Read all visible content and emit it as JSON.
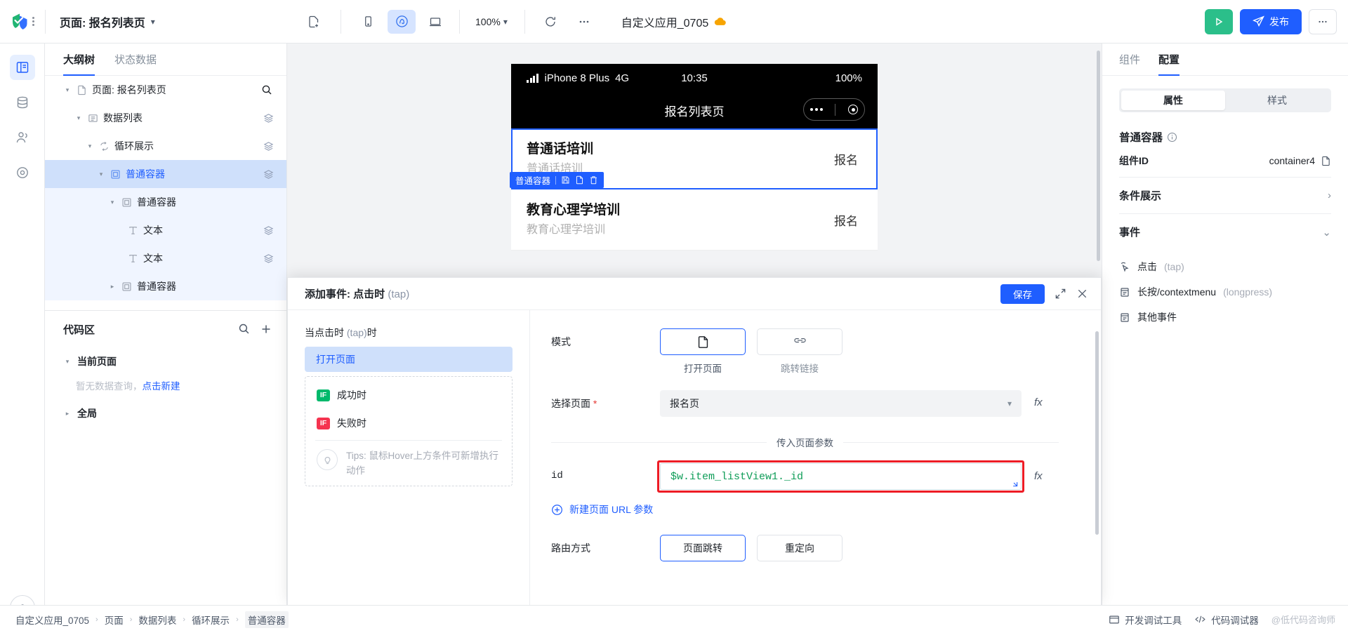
{
  "topbar": {
    "page_label": "页面: 报名列表页",
    "new_page_icon": "file-plus-icon",
    "device_mobile_icon": "mobile-icon",
    "device_miniapp_icon": "miniapp-icon",
    "device_desktop_icon": "desktop-icon",
    "zoom": "100%",
    "refresh_icon": "refresh-icon",
    "more_icon": "ellipsis-icon",
    "app_name": "自定义应用_0705",
    "cloud_icon": "cloud-icon",
    "preview_label": "preview",
    "publish_label": "发布",
    "more_label": "more"
  },
  "rail": {
    "items": [
      {
        "icon": "layout-icon",
        "name": "rail-item-layout",
        "active": true
      },
      {
        "icon": "database-icon",
        "name": "rail-item-data",
        "active": false
      },
      {
        "icon": "users-icon",
        "name": "rail-item-users",
        "active": false
      },
      {
        "icon": "target-icon",
        "name": "rail-item-settings",
        "active": false
      }
    ],
    "help_icon": "question-icon"
  },
  "left_panel": {
    "tabs": [
      {
        "label": "大纲树",
        "active": true
      },
      {
        "label": "状态数据",
        "active": false
      }
    ],
    "search_icon": "search-icon",
    "tree": [
      {
        "label": "页面: 报名列表页",
        "icon": "file-icon",
        "depth": 0,
        "caret": "down",
        "state": "none",
        "layers": false
      },
      {
        "label": "数据列表",
        "icon": "list-icon",
        "depth": 1,
        "caret": "down",
        "state": "none",
        "layers": true
      },
      {
        "label": "循环展示",
        "icon": "loop-icon",
        "depth": 2,
        "caret": "down",
        "state": "none",
        "layers": true
      },
      {
        "label": "普通容器",
        "icon": "container-icon",
        "depth": 3,
        "caret": "down",
        "state": "sel",
        "layers": true
      },
      {
        "label": "普通容器",
        "icon": "container-icon",
        "depth": 4,
        "caret": "down",
        "state": "childsel",
        "layers": false
      },
      {
        "label": "文本",
        "icon": "text-icon",
        "depth": 5,
        "caret": "none",
        "state": "childsel",
        "layers": true
      },
      {
        "label": "文本",
        "icon": "text-icon",
        "depth": 5,
        "caret": "none",
        "state": "childsel",
        "layers": true
      },
      {
        "label": "普通容器",
        "icon": "container-icon",
        "depth": 4,
        "caret": "right",
        "state": "childsel",
        "layers": false
      }
    ],
    "code_section": {
      "title": "代码区",
      "search_icon": "search-icon",
      "add_icon": "plus-icon",
      "current_page_label": "当前页面",
      "empty_text": "暂无数据查询，",
      "empty_link": "点击新建",
      "global_label": "全局"
    }
  },
  "canvas": {
    "phone": {
      "carrier": "iPhone 8 Plus",
      "network": "4G",
      "time": "10:35",
      "battery": "100%",
      "nav_title": "报名列表页",
      "list": [
        {
          "title": "普通话培训",
          "subtitle": "普通话培训",
          "action": "报名",
          "highlight": true
        },
        {
          "title": "教育心理学培训",
          "subtitle": "教育心理学培训",
          "action": "报名",
          "highlight": false
        }
      ],
      "selection_badge": {
        "label": "普通容器",
        "icons": [
          "save-icon",
          "copy-icon",
          "delete-icon"
        ]
      }
    }
  },
  "right_panel": {
    "tabs": [
      {
        "label": "组件",
        "active": false
      },
      {
        "label": "配置",
        "active": true
      }
    ],
    "segments": [
      {
        "label": "属性",
        "active": true
      },
      {
        "label": "样式",
        "active": false
      }
    ],
    "component_title": "普通容器",
    "info_icon": "info-icon",
    "component_id_label": "组件ID",
    "component_id_value": "container4",
    "copy_icon": "copy-icon",
    "sections": [
      {
        "label": "条件展示",
        "chevron": "right"
      },
      {
        "label": "事件",
        "chevron": "down"
      }
    ],
    "events": [
      {
        "icon": "click-icon",
        "label": "点击",
        "muted": "(tap)"
      },
      {
        "icon": "menu-icon",
        "label": "长按/contextmenu",
        "muted": "(longpress)"
      },
      {
        "icon": "menu-icon",
        "label": "其他事件",
        "muted": ""
      }
    ]
  },
  "modal": {
    "title": "添加事件: 点击时",
    "title_muted": "(tap)",
    "save_label": "保存",
    "expand_icon": "expand-icon",
    "close_icon": "close-icon",
    "left": {
      "when_label": "当点击时",
      "when_muted": "(tap)",
      "when_suffix": "时",
      "action": "打开页面",
      "conditions": [
        {
          "badge": "IF",
          "label": "成功时",
          "color": "#00b96b"
        },
        {
          "badge": "IF",
          "label": "失败时",
          "color": "#f5334f"
        }
      ],
      "tips_icon": "bulb-icon",
      "tips": "Tips: 鼠标Hover上方条件可新增执行动作"
    },
    "right": {
      "mode_label": "模式",
      "mode_options": [
        {
          "label": "打开页面",
          "icon": "page-icon",
          "active": true
        },
        {
          "label": "跳转链接",
          "icon": "link-icon",
          "active": false
        }
      ],
      "select_page_label": "选择页面",
      "select_page_required": "*",
      "select_page_value": "报名页",
      "fx_label": "fx",
      "params_divider": "传入页面参数",
      "param_key": "id",
      "param_value": "$w.item_listView1._id",
      "add_param_label": "新建页面 URL 参数",
      "add_param_icon": "plus-circle-icon",
      "route_label": "路由方式",
      "route_options": [
        {
          "label": "页面跳转",
          "active": true
        },
        {
          "label": "重定向",
          "active": false
        }
      ]
    }
  },
  "statusbar": {
    "breadcrumbs": [
      "自定义应用_0705",
      "页面",
      "数据列表",
      "循环展示",
      "普通容器"
    ],
    "devtools_icon": "window-icon",
    "devtools_label": "开发调试工具",
    "code_icon": "code-icon",
    "code_label": "代码调试器",
    "watermark": "@低代码咨询师"
  }
}
